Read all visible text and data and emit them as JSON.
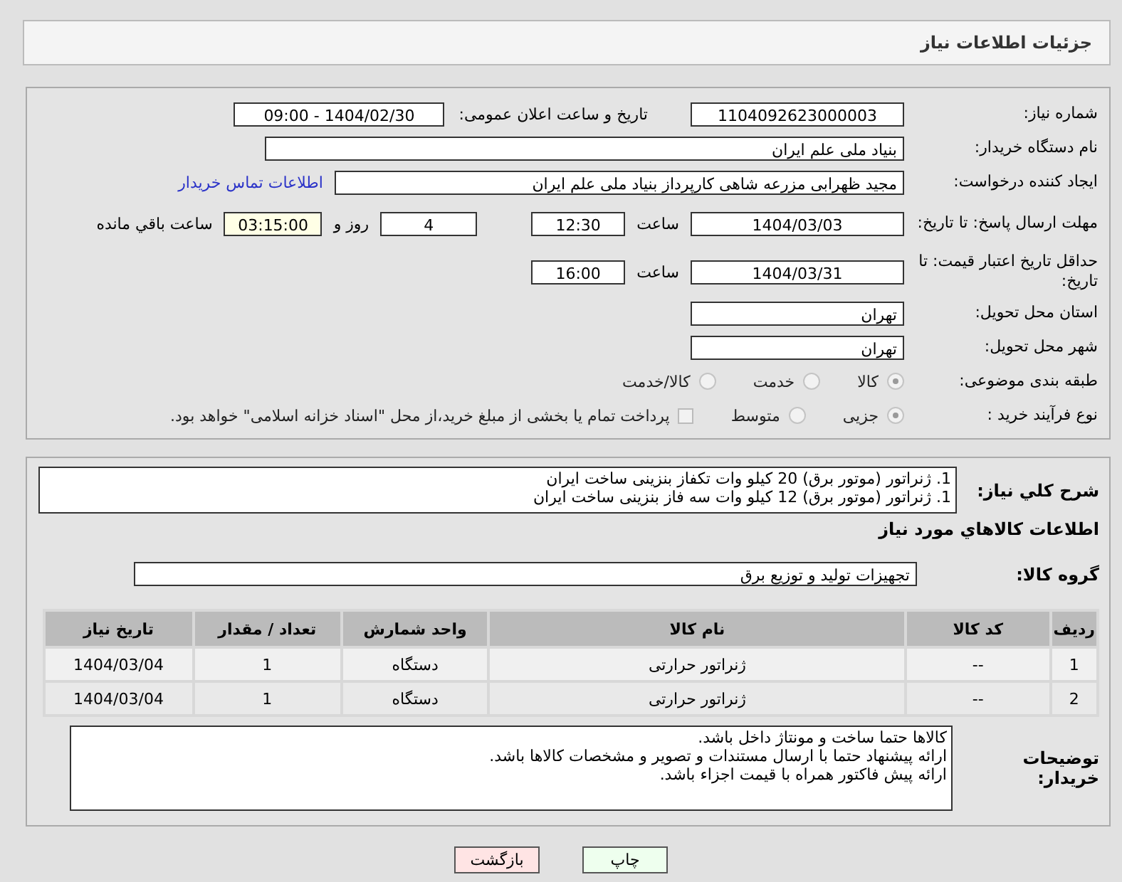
{
  "header": {
    "title": "جزئیات اطلاعات نیاز"
  },
  "details": {
    "need_number": {
      "label": "شماره نیاز:",
      "value": "1104092623000003"
    },
    "announce": {
      "label": "تاریخ و ساعت اعلان عمومی:",
      "value": "1404/02/30 - 09:00"
    },
    "buyer": {
      "label": "نام دستگاه خریدار:",
      "value": "بنیاد ملی علم ایران"
    },
    "creator": {
      "label": "ایجاد کننده درخواست:",
      "value": "مجید  ظهرابی مزرعه شاهی کارپرداز بنیاد ملی علم ایران",
      "link": "اطلاعات تماس خریدار"
    },
    "deadline": {
      "label": "مهلت ارسال پاسخ: تا تاریخ:",
      "date": "1404/03/03",
      "time_label": "ساعت",
      "time": "12:30",
      "days": "4",
      "days_label": "روز و",
      "remaining": "03:15:00",
      "remaining_label": "ساعت باقي مانده"
    },
    "validity": {
      "label": "حداقل تاریخ اعتبار قیمت: تا تاریخ:",
      "date": "1404/03/31",
      "time_label": "ساعت",
      "time": "16:00"
    },
    "province": {
      "label": "استان محل تحویل:",
      "value": "تهران"
    },
    "city": {
      "label": "شهر محل تحویل:",
      "value": "تهران"
    },
    "category": {
      "label": "طبقه بندی موضوعی:",
      "options": [
        {
          "label": "کالا",
          "selected": true
        },
        {
          "label": "خدمت",
          "selected": false
        },
        {
          "label": "کالا/خدمت",
          "selected": false
        }
      ]
    },
    "process": {
      "label": "نوع فرآیند خرید :",
      "options": [
        {
          "label": "جزیی",
          "selected": true
        },
        {
          "label": "متوسط",
          "selected": false
        }
      ],
      "treasury": {
        "checked": false,
        "label": "پرداخت تمام یا بخشی از مبلغ خرید،از محل \"اسناد خزانه اسلامی\" خواهد بود."
      }
    }
  },
  "goods": {
    "description": {
      "label": "شرح کلي نياز:",
      "lines": [
        "1. ژنراتور (موتور برق) 20 کیلو وات تکفاز بنزینی ساخت ایران",
        "1. ژنراتور (موتور برق) 12 کیلو وات سه فاز بنزینی ساخت ایران"
      ]
    },
    "heading": "اطلاعات کالاهاي مورد نياز",
    "group": {
      "label": "گروه کالا:",
      "value": "تجهیزات تولید و توزیع برق"
    },
    "table": {
      "columns": [
        "ردیف",
        "کد کالا",
        "نام کالا",
        "واحد شمارش",
        "تعداد / مقدار",
        "تاریخ نیاز"
      ],
      "rows": [
        [
          "1",
          "--",
          "ژنراتور حرارتی",
          "دستگاه",
          "1",
          "1404/03/04"
        ],
        [
          "2",
          "--",
          "ژنراتور حرارتی",
          "دستگاه",
          "1",
          "1404/03/04"
        ]
      ]
    },
    "notes": {
      "label": "توضیحات خریدار:",
      "lines": [
        "کالاها حتما ساخت و مونتاژ داخل باشد.",
        "ارائه پیشنهاد حتما با ارسال مستندات و تصویر و مشخصات کالاها باشد.",
        "ارائه پیش فاکتور همراه با قیمت اجزاء باشد."
      ]
    }
  },
  "buttons": [
    {
      "label": "چاپ",
      "kind": "print"
    },
    {
      "label": "بازگشت",
      "kind": "back"
    }
  ]
}
